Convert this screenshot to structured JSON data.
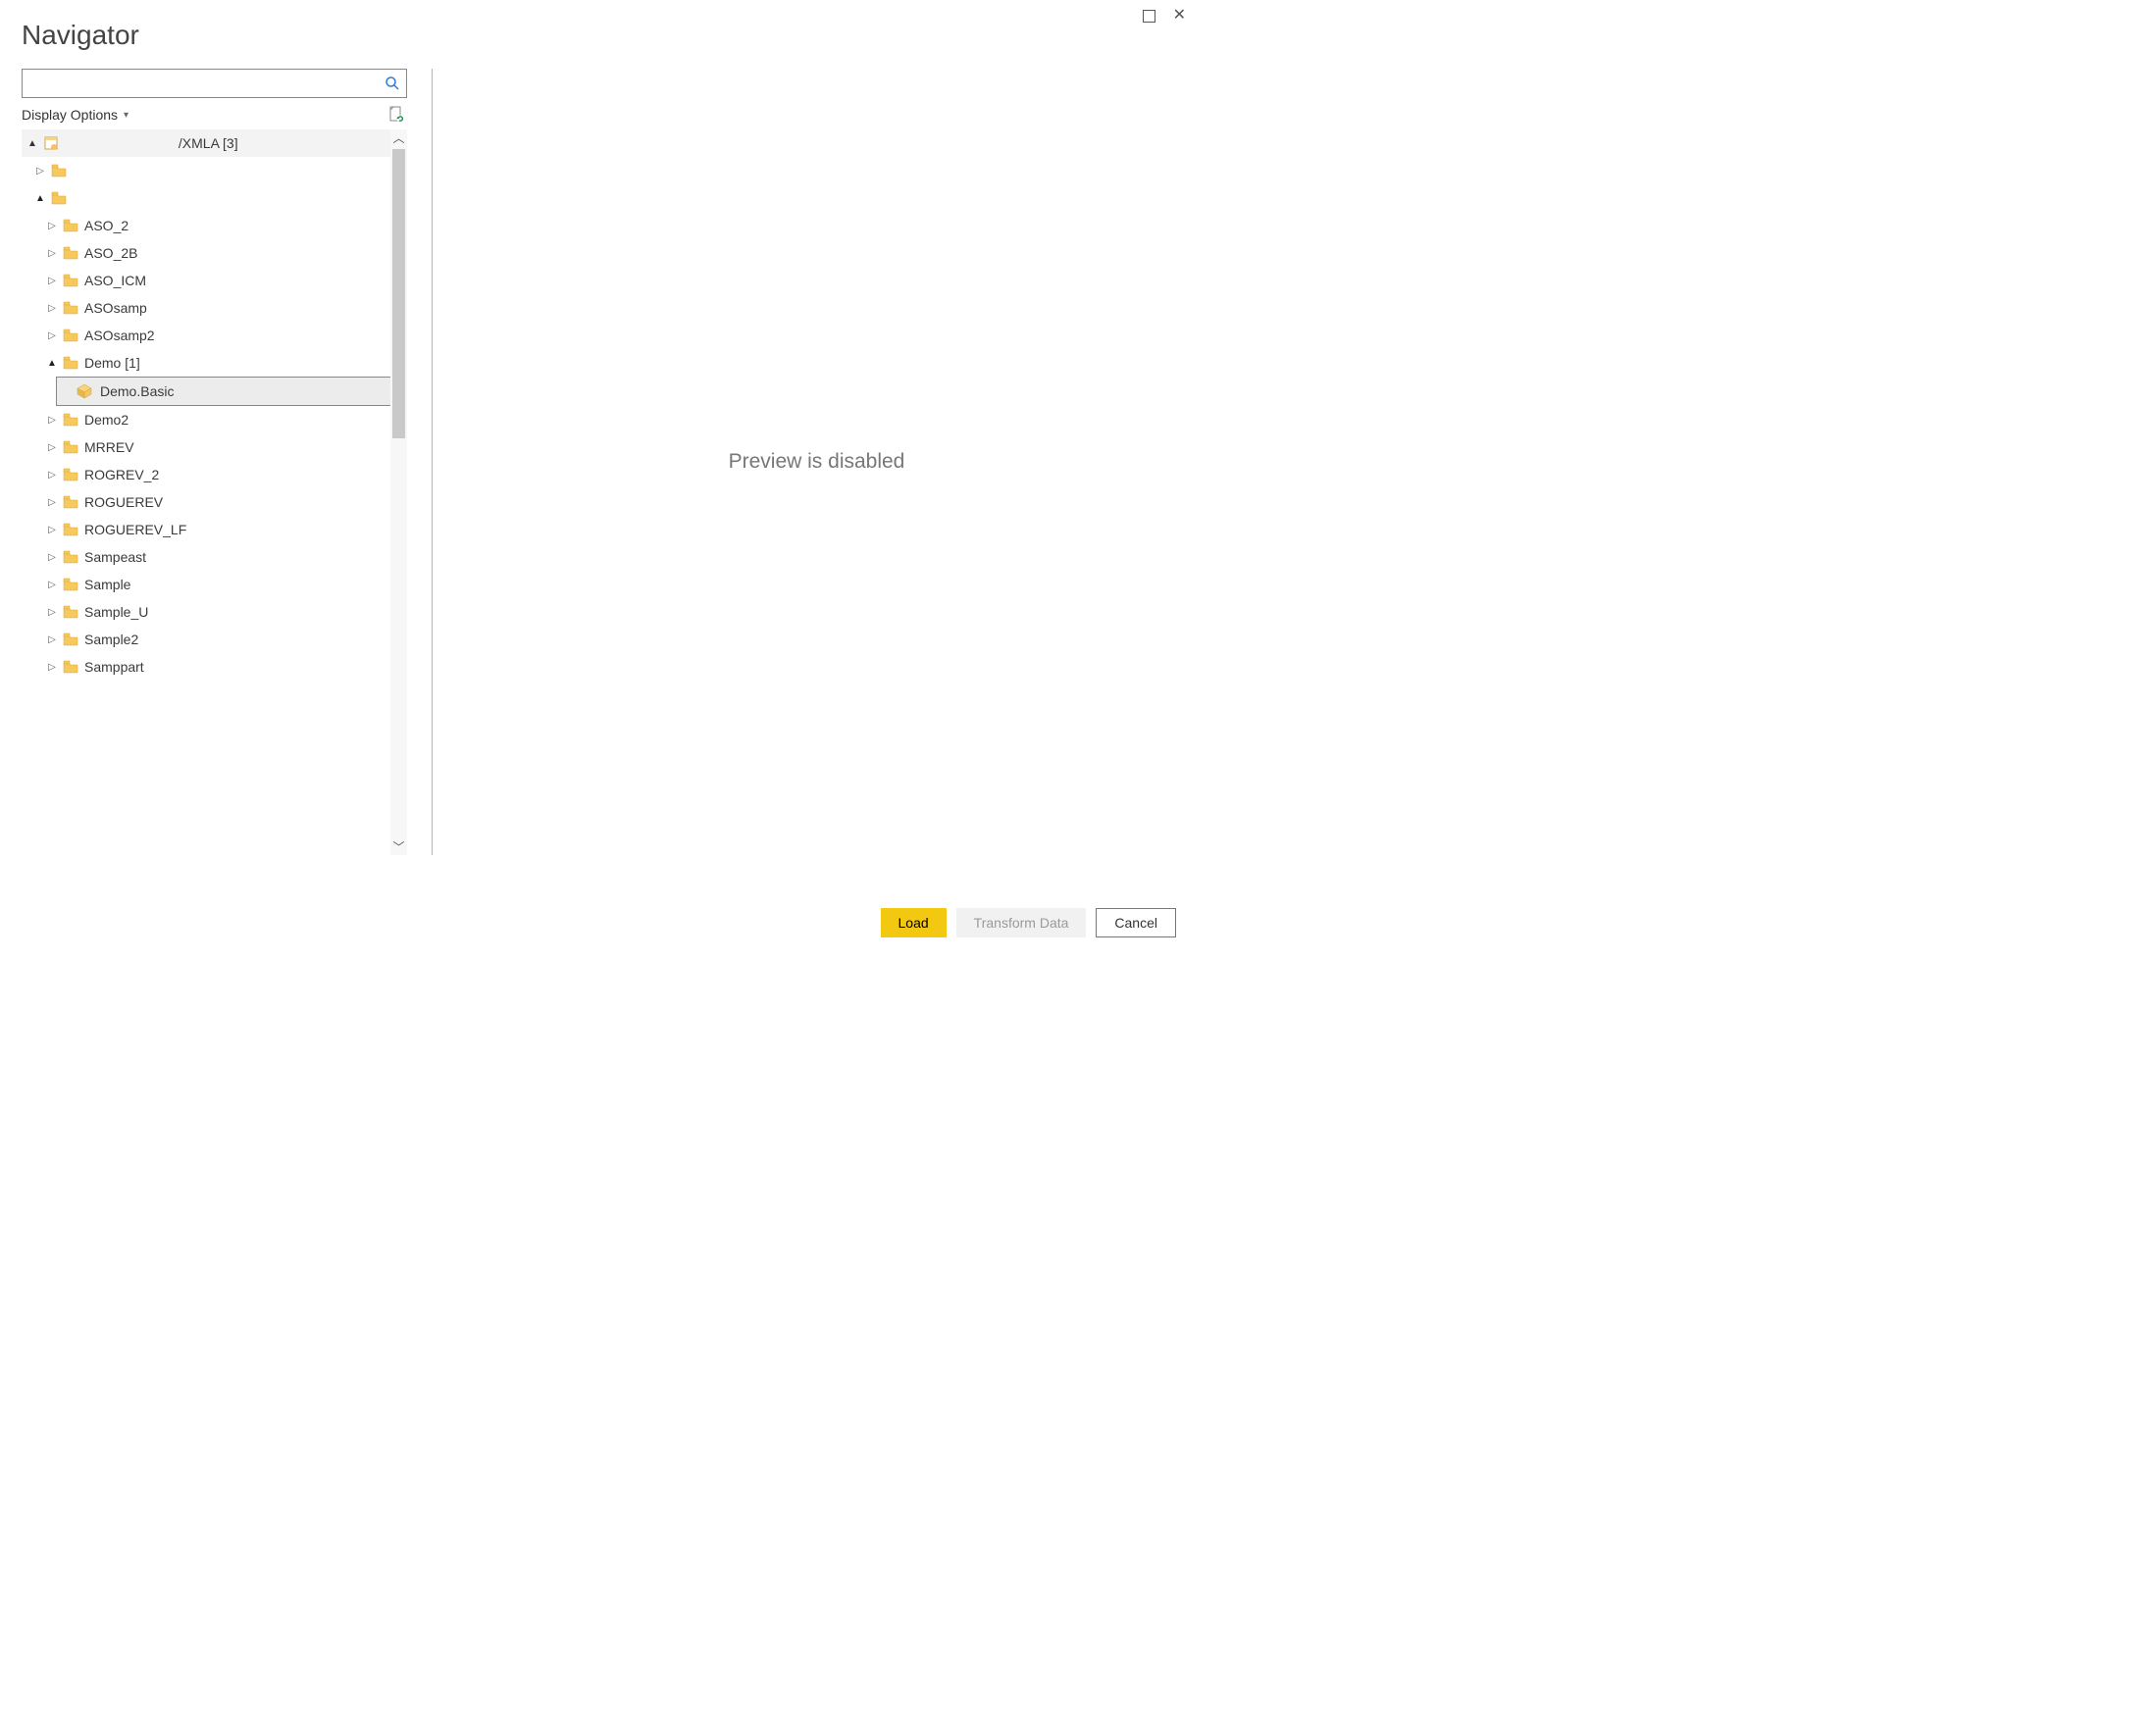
{
  "window": {
    "title": "Navigator"
  },
  "search": {
    "value": "",
    "placeholder": ""
  },
  "options": {
    "display_label": "Display Options"
  },
  "tree": {
    "root_label": "/XMLA [3]",
    "expanded_folder_label": "",
    "demo_label": "Demo [1]",
    "selected_item": "Demo.Basic",
    "items": [
      {
        "label": "ASO_2"
      },
      {
        "label": "ASO_2B"
      },
      {
        "label": "ASO_ICM"
      },
      {
        "label": "ASOsamp"
      },
      {
        "label": "ASOsamp2"
      }
    ],
    "items_after": [
      {
        "label": "Demo2"
      },
      {
        "label": "MRREV"
      },
      {
        "label": "ROGREV_2"
      },
      {
        "label": "ROGUEREV"
      },
      {
        "label": "ROGUEREV_LF"
      },
      {
        "label": "Sampeast"
      },
      {
        "label": "Sample"
      },
      {
        "label": "Sample_U"
      },
      {
        "label": "Sample2"
      },
      {
        "label": "Samppart"
      }
    ]
  },
  "preview": {
    "message": "Preview is disabled"
  },
  "buttons": {
    "load": "Load",
    "transform": "Transform Data",
    "cancel": "Cancel"
  }
}
